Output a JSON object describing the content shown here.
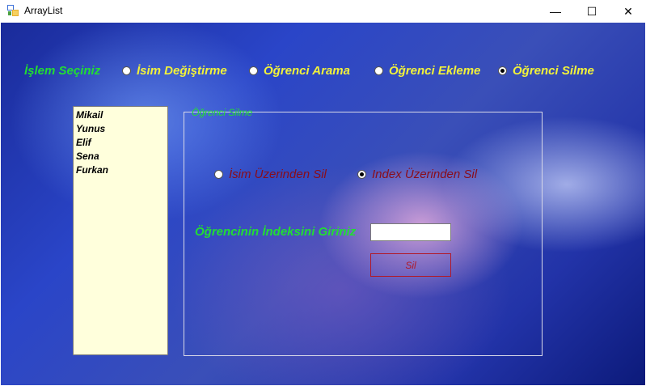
{
  "window": {
    "title": "ArrayList",
    "minimize_glyph": "—",
    "maximize_glyph": "☐",
    "close_glyph": "✕"
  },
  "operations": {
    "label": "İşlem Seçiniz",
    "options": [
      {
        "label": "İsim Değiştirme",
        "checked": false
      },
      {
        "label": "Öğrenci Arama",
        "checked": false
      },
      {
        "label": "Öğrenci Ekleme",
        "checked": false
      },
      {
        "label": "Öğrenci Silme",
        "checked": true
      }
    ]
  },
  "student_list": {
    "items": [
      "Mikail",
      "Yunus",
      "Elif",
      "Sena",
      "Furkan"
    ]
  },
  "delete_group": {
    "title": "Öğrenci Silme",
    "mode_options": [
      {
        "label": "İsim Üzerinden Sil",
        "checked": false
      },
      {
        "label": "Index Üzerinden Sil",
        "checked": true
      }
    ],
    "index_prompt": "Öğrencinin İndeksini Giriniz",
    "index_value": "",
    "delete_button": "Sil"
  },
  "colors": {
    "accent_green": "#22dd33",
    "option_yellow": "#f2f23a",
    "dark_red": "#8a0d1a",
    "list_background": "#ffffdc"
  }
}
